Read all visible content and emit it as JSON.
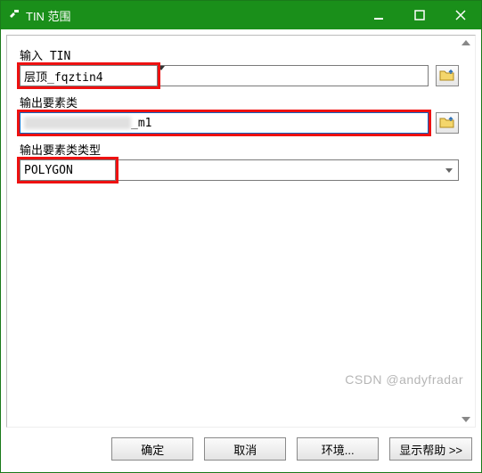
{
  "titlebar": {
    "icon": "hammer",
    "title": "TIN 范围"
  },
  "fields": {
    "input_tin": {
      "label": "输入 TIN",
      "value": "层顶_fqztin4"
    },
    "output_fc": {
      "label": "输出要素类",
      "value_suffix": "_m1"
    },
    "output_type": {
      "label": "输出要素类类型",
      "value": "POLYGON"
    }
  },
  "buttons": {
    "ok": "确定",
    "cancel": "取消",
    "env": "环境...",
    "help": "显示帮助 >>"
  },
  "watermark": "CSDN @andyfradar"
}
